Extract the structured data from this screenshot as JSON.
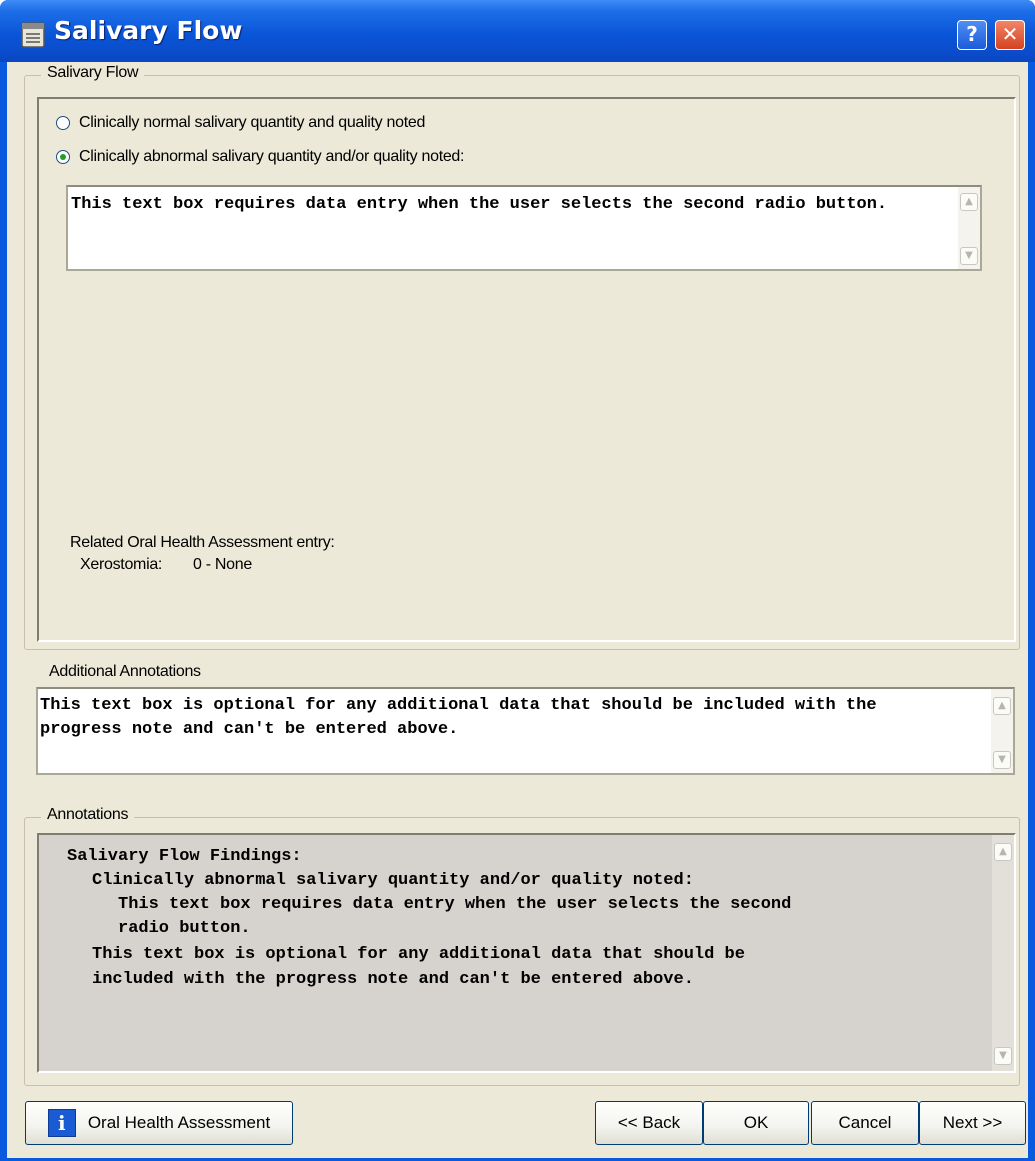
{
  "window": {
    "title": "Salivary Flow",
    "help_label": "?",
    "close_label": "✕"
  },
  "salivary_group": {
    "legend": "Salivary Flow",
    "options": [
      {
        "label": "Clinically normal salivary quantity and quality noted",
        "selected": false
      },
      {
        "label": "Clinically abnormal salivary quantity and/or quality noted:",
        "selected": true
      }
    ],
    "abnormal_text": "This text box requires data entry when the user selects the second radio button.",
    "related_label": "Related Oral Health Assessment entry:",
    "related_key": "Xerostomia:",
    "related_value": "0 - None"
  },
  "additional": {
    "label": "Additional Annotations",
    "text": "This text box is optional for any additional data that should be included with the progress note and can't be entered above."
  },
  "annotations": {
    "legend": "Annotations",
    "lines": [
      "Salivary Flow Findings:",
      "Clinically abnormal salivary quantity and/or quality noted:",
      "This text box requires data entry when the user selects the second",
      "radio button.",
      "This text box is optional for any additional data that should be",
      "included with the progress note and can't be entered above."
    ]
  },
  "footer": {
    "oha_label": "Oral Health Assessment",
    "back_label": "<< Back",
    "ok_label": "OK",
    "cancel_label": "Cancel",
    "next_label": "Next >>"
  },
  "icons": {
    "app": "notepad-icon",
    "info": "info-icon",
    "scroll_up": "arrow-up-icon",
    "scroll_down": "arrow-down-icon"
  }
}
